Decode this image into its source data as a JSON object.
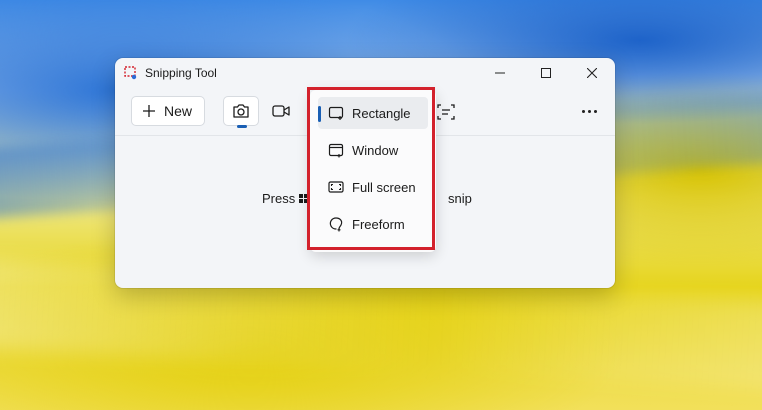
{
  "window": {
    "title": "Snipping Tool"
  },
  "toolbar": {
    "new_label": "New",
    "mode_photo_icon": "camera-icon",
    "mode_video_icon": "video-icon",
    "text_action_icon": "text-actions-icon",
    "more_icon": "more-options-icon"
  },
  "content": {
    "hint_prefix": "Press",
    "hint_suffix": "snip"
  },
  "snip_mode_menu": {
    "items": [
      {
        "label": "Rectangle",
        "icon": "rectangle-snip-icon",
        "selected": true
      },
      {
        "label": "Window",
        "icon": "window-snip-icon",
        "selected": false
      },
      {
        "label": "Full screen",
        "icon": "fullscreen-snip-icon",
        "selected": false
      },
      {
        "label": "Freeform",
        "icon": "freeform-snip-icon",
        "selected": false
      }
    ]
  },
  "colors": {
    "accent": "#1a5fb4",
    "highlight_border": "#d3212c"
  }
}
